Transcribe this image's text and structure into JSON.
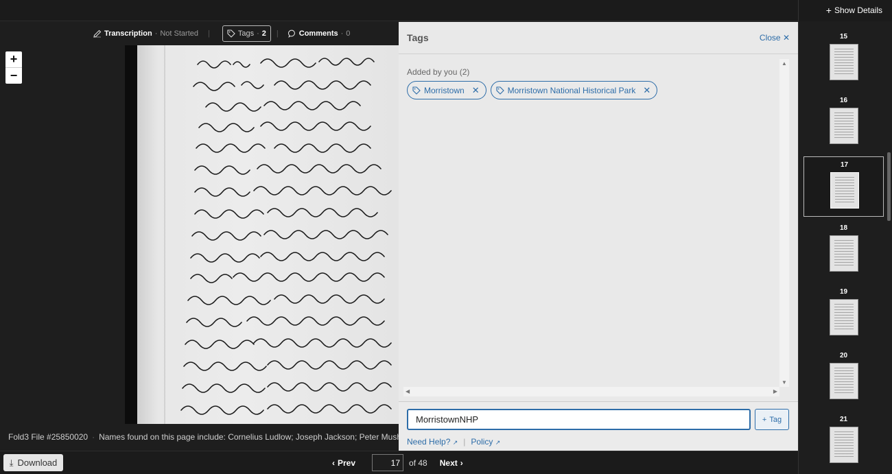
{
  "header": {
    "show_details": "Show Details"
  },
  "toolbar": {
    "transcription_label": "Transcription",
    "transcription_status": "Not Started",
    "tags_label": "Tags",
    "tags_count": "2",
    "comments_label": "Comments",
    "comments_count": "0"
  },
  "zoom": {
    "in": "+",
    "out": "−"
  },
  "file": {
    "id": "Fold3 File #25850020",
    "names": "Names found on this page include: Cornelius Ludlow; Joseph Jackson; Peter Mush…"
  },
  "tags_panel": {
    "title": "Tags",
    "close_label": "Close",
    "added_by": "Added by you (2)",
    "tags": [
      "Morristown",
      "Morristown National Historical Park"
    ],
    "input_value": "MorristownNHP",
    "tag_button": "Tag",
    "help_link": "Need Help?",
    "policy_link": "Policy"
  },
  "thumbnails": [
    {
      "num": "15"
    },
    {
      "num": "16"
    },
    {
      "num": "17",
      "active": true
    },
    {
      "num": "18"
    },
    {
      "num": "19"
    },
    {
      "num": "20"
    },
    {
      "num": "21"
    }
  ],
  "footer": {
    "download": "Download",
    "prev": "Prev",
    "page": "17",
    "of": "of 48",
    "next": "Next"
  },
  "colors": {
    "accent": "#2c6ca8",
    "dark_bg": "#1e1e1e",
    "panel_bg": "#e9e9e9"
  }
}
